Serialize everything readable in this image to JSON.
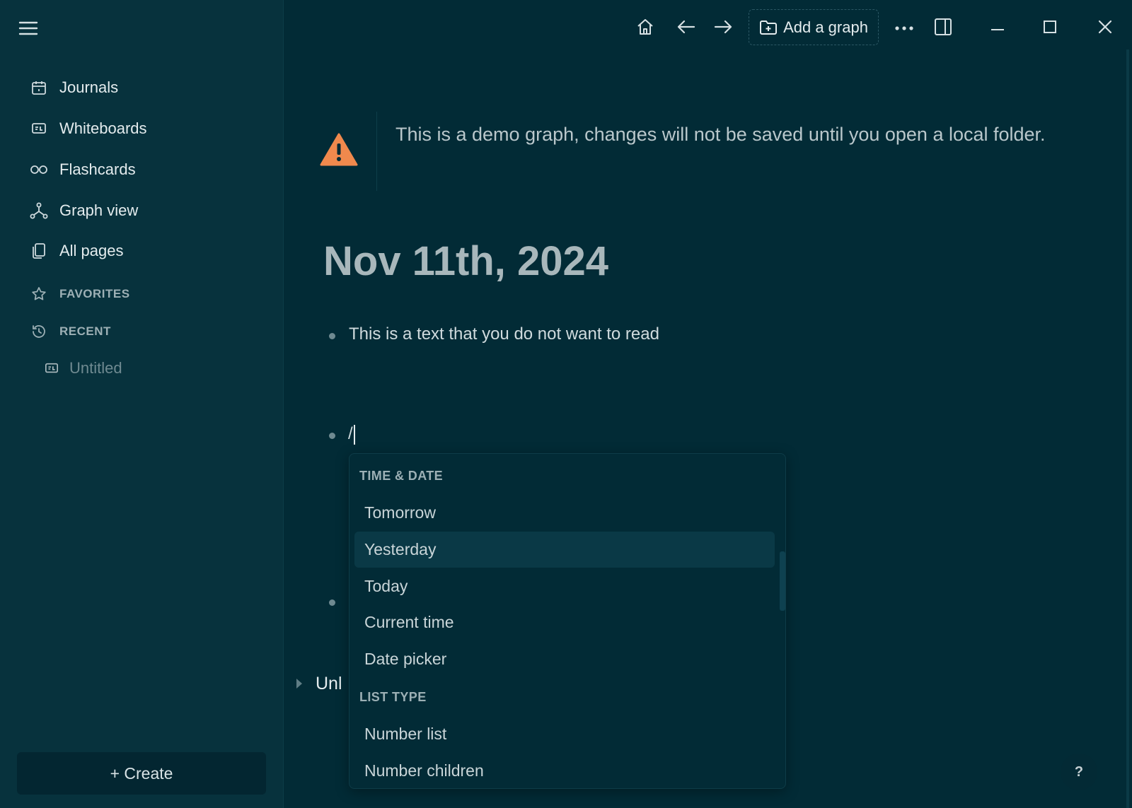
{
  "sidebar": {
    "nav": [
      {
        "label": "Journals",
        "icon": "calendar-icon"
      },
      {
        "label": "Whiteboards",
        "icon": "whiteboard-icon"
      },
      {
        "label": "Flashcards",
        "icon": "infinity-icon"
      },
      {
        "label": "Graph view",
        "icon": "graph-icon"
      },
      {
        "label": "All pages",
        "icon": "pages-icon"
      }
    ],
    "favorites_label": "FAVORITES",
    "recent_label": "RECENT",
    "recent_items": [
      {
        "label": "Untitled",
        "icon": "whiteboard-icon"
      }
    ],
    "create_label": "+ Create"
  },
  "toolbar": {
    "add_graph_label": "Add a graph"
  },
  "warning": {
    "text": "This is a demo graph, changes will not be saved until you open a local folder."
  },
  "page": {
    "title": "Nov 11th, 2024",
    "blocks": [
      {
        "text": "This is a text that you do not want to read"
      },
      {
        "text": "/"
      }
    ],
    "unlinked_label": "Unl"
  },
  "command_menu": {
    "sections": [
      {
        "heading": "TIME & DATE",
        "items": [
          "Tomorrow",
          "Yesterday",
          "Today",
          "Current time",
          "Date picker"
        ]
      },
      {
        "heading": "LIST TYPE",
        "items": [
          "Number list",
          "Number children"
        ]
      }
    ],
    "active_item": "Yesterday"
  },
  "help_label": "?",
  "colors": {
    "background": "#022b36",
    "sidebar": "#07323d",
    "warning": "#f0894d"
  }
}
